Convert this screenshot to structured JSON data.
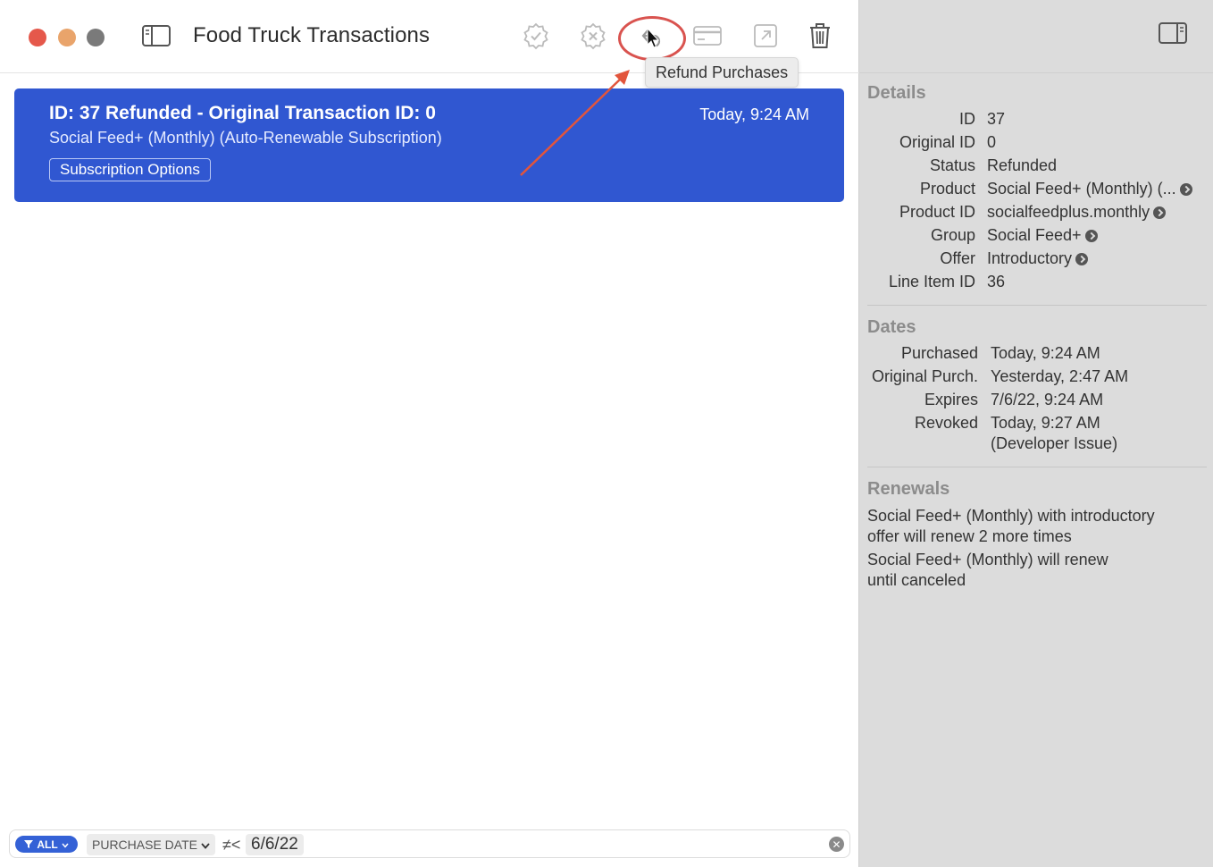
{
  "window": {
    "title": "Food Truck Transactions"
  },
  "toolbar": {
    "tooltip": "Refund Purchases",
    "icons": [
      "sidebar-icon",
      "approve-icon",
      "decline-icon",
      "refund-icon",
      "card-icon",
      "export-icon",
      "trash-icon"
    ]
  },
  "transaction": {
    "title": "ID: 37 Refunded - Original Transaction ID: 0",
    "date": "Today, 9:24 AM",
    "subtitle": "Social Feed+ (Monthly) (Auto-Renewable Subscription)",
    "button_label": "Subscription Options"
  },
  "filter": {
    "scope": "ALL",
    "field": "PURCHASE DATE",
    "operator": "≠<",
    "value": "6/6/22"
  },
  "details": {
    "heading": "Details",
    "rows": [
      {
        "key": "ID",
        "value": "37"
      },
      {
        "key": "Original ID",
        "value": "0"
      },
      {
        "key": "Status",
        "value": "Refunded"
      },
      {
        "key": "Product",
        "value": "Social Feed+ (Monthly) (..."
      },
      {
        "key": "Product ID",
        "value": "socialfeedplus.monthly"
      },
      {
        "key": "Group",
        "value": "Social Feed+"
      },
      {
        "key": "Offer",
        "value": "Introductory"
      },
      {
        "key": "Line Item ID",
        "value": "36"
      }
    ]
  },
  "dates": {
    "heading": "Dates",
    "rows": [
      {
        "key": "Purchased",
        "value": "Today, 9:24 AM"
      },
      {
        "key": "Original Purch.",
        "value": "Yesterday, 2:47 AM"
      },
      {
        "key": "Expires",
        "value": "7/6/22, 9:24 AM"
      },
      {
        "key": "Revoked",
        "value": "Today, 9:27 AM"
      }
    ],
    "revoked_reason": "(Developer Issue)"
  },
  "renewals": {
    "heading": "Renewals",
    "items": [
      {
        "line1": "Social Feed+ (Monthly) with introductory",
        "line2": "offer will renew 2 more times"
      },
      {
        "line1": "Social Feed+ (Monthly) will renew",
        "line2": "until canceled"
      }
    ]
  },
  "colors": {
    "selection": "#3057d1",
    "annotation": "#d9534f",
    "inspector_bg": "#dcdcdc"
  }
}
